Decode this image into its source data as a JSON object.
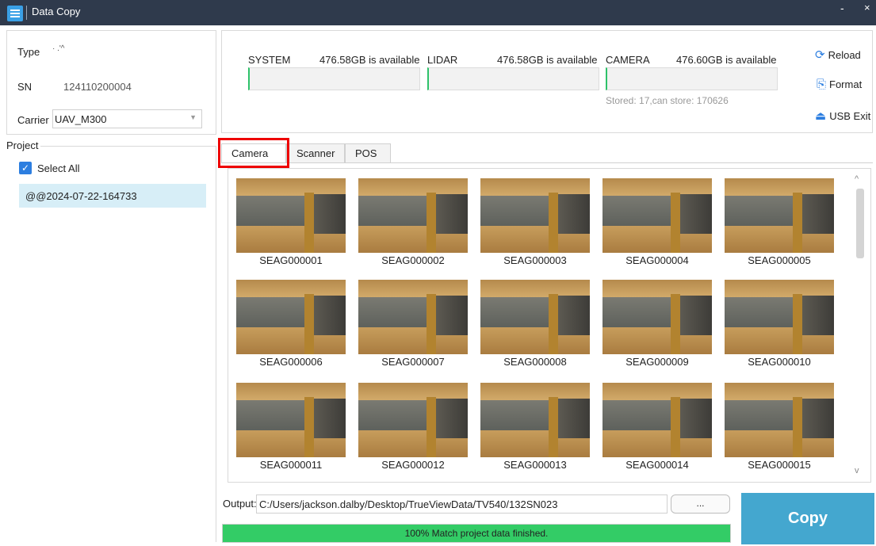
{
  "window": {
    "title": "Data Copy",
    "minimize": "-",
    "close": "×"
  },
  "device": {
    "type_label": "Type",
    "type_value": "· .'^",
    "sn_label": "SN",
    "sn_value": "124110200004",
    "carrier_label": "Carrier",
    "carrier_value": "UAV_M300"
  },
  "project": {
    "legend": "Project",
    "select_all_label": "Select All",
    "select_all_checked": true,
    "items": [
      "@@2024-07-22-164733"
    ]
  },
  "storage": {
    "drives": [
      {
        "name": "SYSTEM",
        "available": "476.58GB is available"
      },
      {
        "name": "LIDAR",
        "available": "476.58GB is available"
      },
      {
        "name": "CAMERA",
        "available": "476.60GB is available"
      }
    ],
    "stored_note": "Stored: 17,can store: 170626"
  },
  "actions": {
    "reload": "Reload",
    "format": "Format",
    "usb_exit": "USB Exit"
  },
  "tabs": [
    "Camera",
    "Scanner",
    "POS"
  ],
  "active_tab": "Camera",
  "gallery": {
    "images": [
      "SEAG000001",
      "SEAG000002",
      "SEAG000003",
      "SEAG000004",
      "SEAG000005",
      "SEAG000006",
      "SEAG000007",
      "SEAG000008",
      "SEAG000009",
      "SEAG000010",
      "SEAG000011",
      "SEAG000012",
      "SEAG000013",
      "SEAG000014",
      "SEAG000015"
    ]
  },
  "output": {
    "label": "Output:",
    "path": "C:/Users/jackson.dalby/Desktop/TrueViewData/TV540/132SN023",
    "browse_label": "..."
  },
  "progress": {
    "percent": 100,
    "text": "100% Match project data finished."
  },
  "copy_button": "Copy",
  "colors": {
    "titlebar": "#2f3a4c",
    "accent": "#2c7ee0",
    "copy_button": "#44a7cf",
    "progress": "#33cc66",
    "highlight": "#e00000"
  }
}
